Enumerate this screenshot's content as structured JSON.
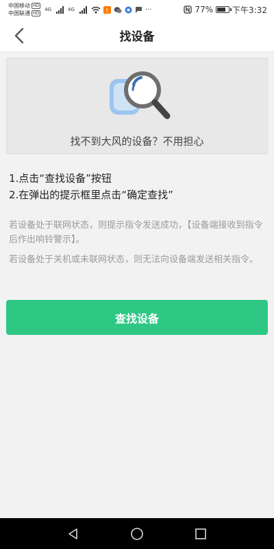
{
  "status_bar": {
    "carrier_1": "中国移动",
    "carrier_2": "中国联通",
    "hd": "HD",
    "net_1": "4G",
    "net_2": "4G",
    "battery_text": "77%",
    "battery_level": 0.77,
    "time": "下午3:32"
  },
  "header": {
    "title": "找设备"
  },
  "banner": {
    "text": "找不到大风的设备？不用担心"
  },
  "steps": [
    "1.点击“查找设备”按钮",
    "2.在弹出的提示框里点击“确定查找”"
  ],
  "notes": [
    "若设备处于联网状态，则提示指令发送成功，【设备端接收到指令后作出响铃警示】。",
    "若设备处于关机或未联网状态，则无法向设备端发送相关指令。"
  ],
  "action": {
    "label": "查找设备"
  },
  "colors": {
    "accent": "#2ec784",
    "note_text": "#9a9a9a"
  }
}
